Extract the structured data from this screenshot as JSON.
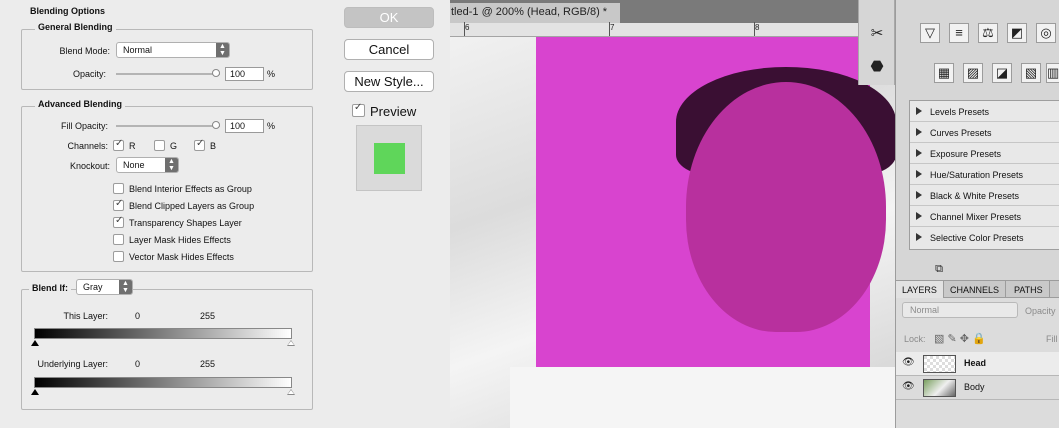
{
  "dialog": {
    "blending_options_label": "Blending Options",
    "general": {
      "title": "General Blending",
      "blend_mode_label": "Blend Mode:",
      "blend_mode_value": "Normal",
      "opacity_label": "Opacity:",
      "opacity_value": "100",
      "opacity_unit": "%",
      "opacity_level": 1.0
    },
    "advanced": {
      "title": "Advanced Blending",
      "fill_opacity_label": "Fill Opacity:",
      "fill_opacity_value": "100",
      "fill_opacity_unit": "%",
      "fill_opacity_level": 1.0,
      "channels_label": "Channels:",
      "channels": [
        {
          "label": "R",
          "checked": true
        },
        {
          "label": "G",
          "checked": false
        },
        {
          "label": "B",
          "checked": true
        }
      ],
      "knockout_label": "Knockout:",
      "knockout_value": "None",
      "options": [
        {
          "label": "Blend Interior Effects as Group",
          "checked": false
        },
        {
          "label": "Blend Clipped Layers as Group",
          "checked": true
        },
        {
          "label": "Transparency Shapes Layer",
          "checked": true
        },
        {
          "label": "Layer Mask Hides Effects",
          "checked": false
        },
        {
          "label": "Vector Mask Hides Effects",
          "checked": false
        }
      ]
    },
    "blend_if": {
      "label": "Blend If:",
      "value": "Gray",
      "this_layer_label": "This Layer:",
      "this_layer_low": "0",
      "this_layer_high": "255",
      "underlying_label": "Underlying Layer:",
      "underlying_low": "0",
      "underlying_high": "255"
    }
  },
  "buttons": {
    "ok": "OK",
    "cancel": "Cancel",
    "new_style": "New Style...",
    "preview": "Preview",
    "preview_checked": true,
    "preview_swatch_color": "#5fd65a"
  },
  "document": {
    "tab_title": "tled-1 @ 200% (Head, RGB/8) *",
    "ruler_numbers": [
      "6",
      "7",
      "8"
    ],
    "overlay_color": "#d844cf"
  },
  "tools": {
    "icons": [
      "scissors-tools-icon",
      "stamp-tool-icon"
    ]
  },
  "adjustments": {
    "icons_row1": [
      "vibrance-icon",
      "hsl-icon",
      "color-balance-icon",
      "black-white-icon",
      "photo-filter-icon"
    ],
    "icons_row2": [
      "channel-mixer-icon",
      "gradient-map-icon",
      "selective-color-icon",
      "threshold-icon",
      "gradient-icon"
    ],
    "presets": [
      "Levels Presets",
      "Curves Presets",
      "Exposure Presets",
      "Hue/Saturation Presets",
      "Black & White Presets",
      "Channel Mixer Presets",
      "Selective Color Presets"
    ]
  },
  "layers_panel": {
    "tabs": [
      "LAYERS",
      "CHANNELS",
      "PATHS"
    ],
    "mode": "Normal",
    "opacity_label": "Opacity",
    "lock_label": "Lock:",
    "fill_label": "Fill",
    "layers": [
      {
        "name": "Head",
        "selected": true
      },
      {
        "name": "Body",
        "selected": false
      }
    ]
  }
}
